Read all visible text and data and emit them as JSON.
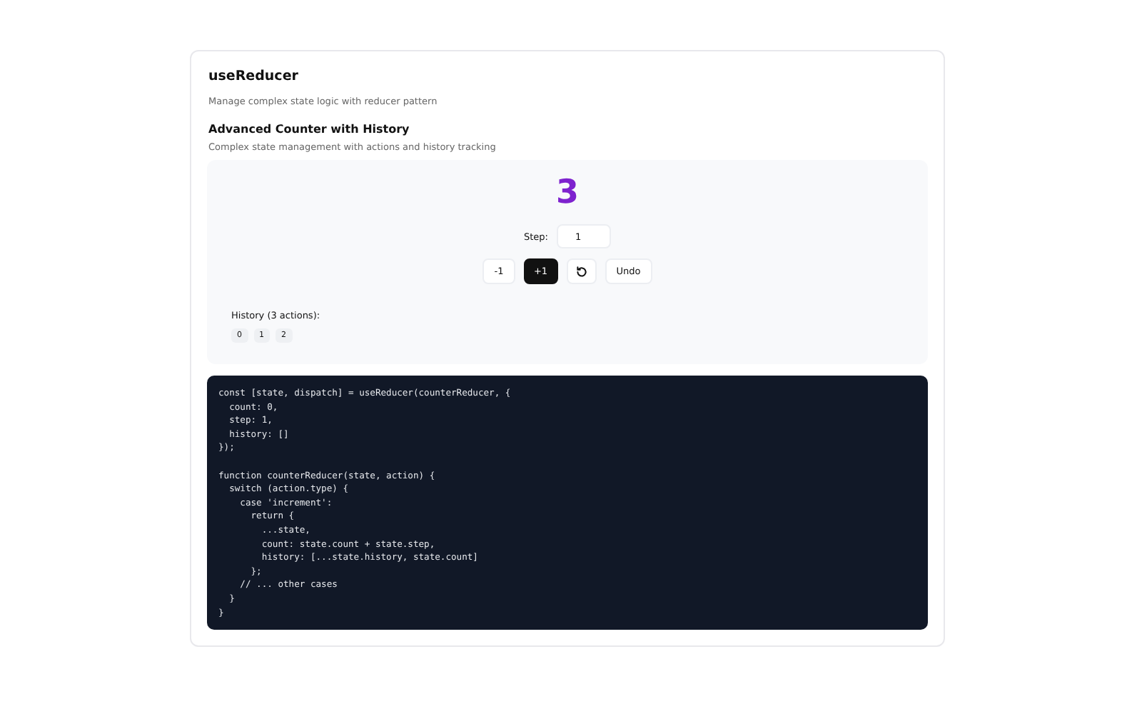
{
  "title": "useReducer",
  "subtitle": "Manage complex state logic with reducer pattern",
  "section": {
    "title": "Advanced Counter with History",
    "description": "Complex state management with actions and history tracking"
  },
  "counter": {
    "value": "3",
    "step_label": "Step:",
    "step_value": "1",
    "buttons": [
      {
        "kind": "text",
        "label": "-1",
        "primary": false
      },
      {
        "kind": "text",
        "label": "+1",
        "primary": true
      },
      {
        "kind": "icon",
        "primary": false
      },
      {
        "kind": "text",
        "label": "Undo",
        "primary": false
      }
    ],
    "history_label": "History (3 actions):",
    "history": [
      "0",
      "1",
      "2"
    ]
  },
  "code": [
    [
      "const [state, dispatch] = useReducer(counterReducer, {",
      "  count: 0,",
      "  step: 1,",
      "  history: []",
      "});"
    ],
    [
      "function counterReducer(state, action) {",
      "  switch (action.type) {",
      "    case 'increment':",
      "      return {",
      "        ...state,",
      "        count: state.count + state.step,",
      "        history: [...state.history, state.count]",
      "      };",
      "    // ... other cases",
      "  }",
      "}"
    ]
  ]
}
